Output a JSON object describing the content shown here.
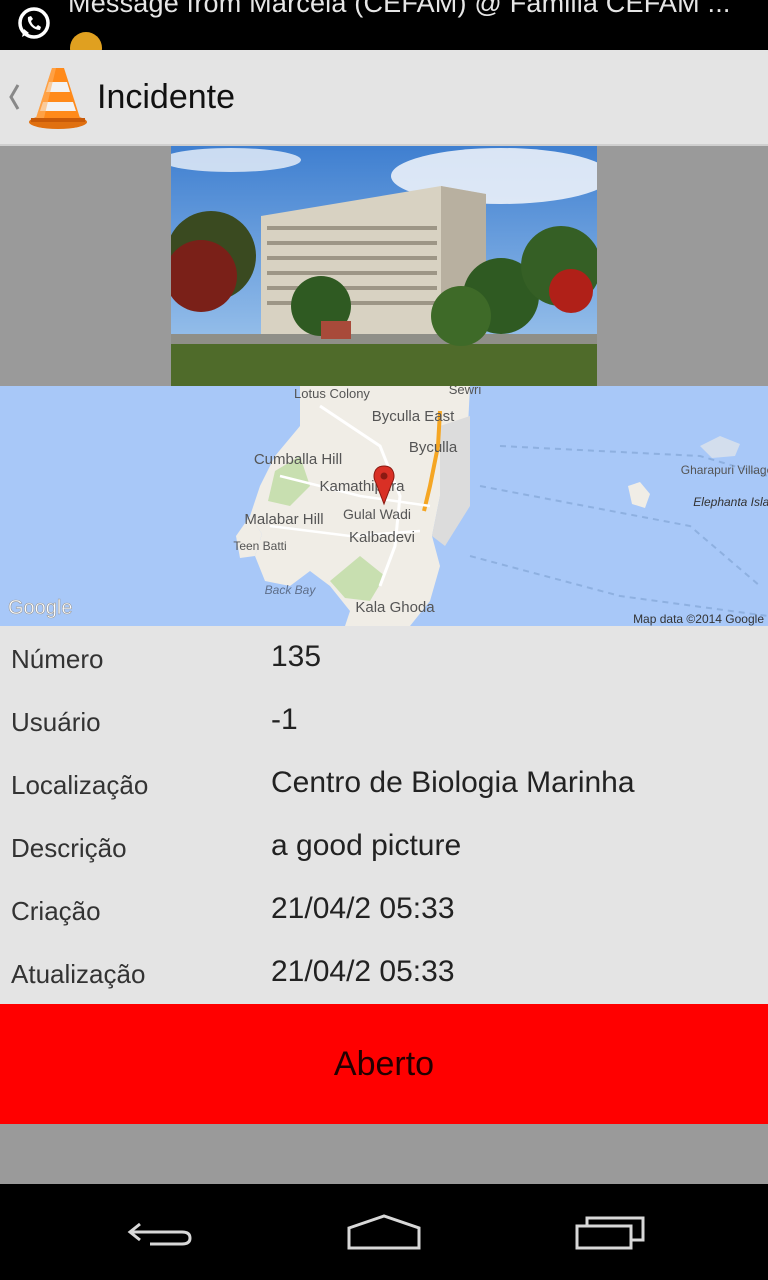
{
  "status_bar": {
    "notification_text": "Message from Marcela (CEFAM) @ Familia CEFAM ...",
    "app_icon": "whatsapp-icon",
    "secondary_icon": "emoji-icon"
  },
  "action_bar": {
    "title": "Incidente",
    "app_icon": "traffic-cone-icon",
    "up_icon": "chevron-left-icon"
  },
  "map": {
    "labels": {
      "lotus_colony": "Lotus Colony",
      "sewri": "Sewri",
      "byculla_east": "Byculla East",
      "byculla": "Byculla",
      "cumballa_hill": "Cumballa Hill",
      "kamathipura": "Kamathipura",
      "malabar_hill": "Malabar Hill",
      "gulal_wadi": "Gulal Wadi",
      "kalbadevi": "Kalbadevi",
      "teen_batti": "Teen Batti",
      "back_bay": "Back Bay",
      "kala_ghoda": "Kala Ghoda",
      "gharapuri_village": "Gharapuri Village",
      "elephanta_island": "Elephanta Island"
    },
    "logo": "Google",
    "attribution": "Map data ©2014 Google",
    "marker_icon": "map-pin-icon"
  },
  "details": [
    {
      "label": "Número",
      "value": "135"
    },
    {
      "label": "Usuário",
      "value": "-1"
    },
    {
      "label": "Localização",
      "value": "Centro de Biologia Marinha"
    },
    {
      "label": "Descrição",
      "value": "a good picture"
    },
    {
      "label": "Criação",
      "value": "21/04/2 05:33"
    },
    {
      "label": "Atualização",
      "value": "21/04/2 05:33"
    }
  ],
  "status": {
    "label": "Aberto",
    "color": "#ff0000"
  },
  "nav": {
    "back_icon": "back-icon",
    "home_icon": "home-icon",
    "recents_icon": "recents-icon"
  },
  "colors": {
    "action_bar_bg": "#e4e4e4",
    "map_water": "#a8c8f8",
    "status_open": "#ff0000"
  }
}
